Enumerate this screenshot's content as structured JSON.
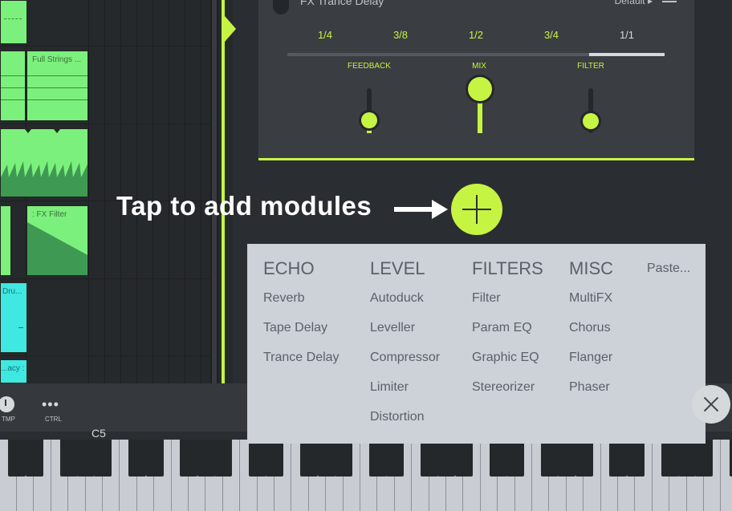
{
  "fx_panel": {
    "title": "FX Trance Delay",
    "preset": "Default",
    "preset_arrow": "▸",
    "time_options": [
      "1/4",
      "3/8",
      "1/2",
      "3/4",
      "1/1"
    ],
    "selected_time": "1/1",
    "knobs": [
      {
        "label": "FEEDBACK",
        "value": 0.2
      },
      {
        "label": "MIX",
        "value": 1.0
      },
      {
        "label": "FILTER",
        "value": 0.25
      }
    ]
  },
  "playlist": {
    "clips": [
      "Full Strings ...",
      ": FX Filter",
      "Dru...",
      "...acy : ..."
    ]
  },
  "hint": {
    "text": "Tap to add modules"
  },
  "toolbar": {
    "tmp_label": "TMP",
    "ctrl_label": "CTRL",
    "ctrl_dots": "•••",
    "octave_label": "C5"
  },
  "module_menu": {
    "categories": [
      {
        "name": "ECHO",
        "items": [
          "Reverb",
          "Tape Delay",
          "Trance Delay"
        ]
      },
      {
        "name": "LEVEL",
        "items": [
          "Autoduck",
          "Leveller",
          "Compressor",
          "Limiter",
          "Distortion"
        ]
      },
      {
        "name": "FILTERS",
        "items": [
          "Filter",
          "Param EQ",
          "Graphic EQ",
          "Stereorizer"
        ]
      },
      {
        "name": "MISC",
        "items": [
          "MultiFX",
          "Chorus",
          "Flanger",
          "Phaser"
        ]
      }
    ],
    "paste": "Paste..."
  },
  "colors": {
    "accent": "#c6f442",
    "green_clip": "#7cf07c",
    "cyan_clip": "#40e8e2",
    "panel": "#3a3d42",
    "menu_bg": "#cdd1d8"
  }
}
